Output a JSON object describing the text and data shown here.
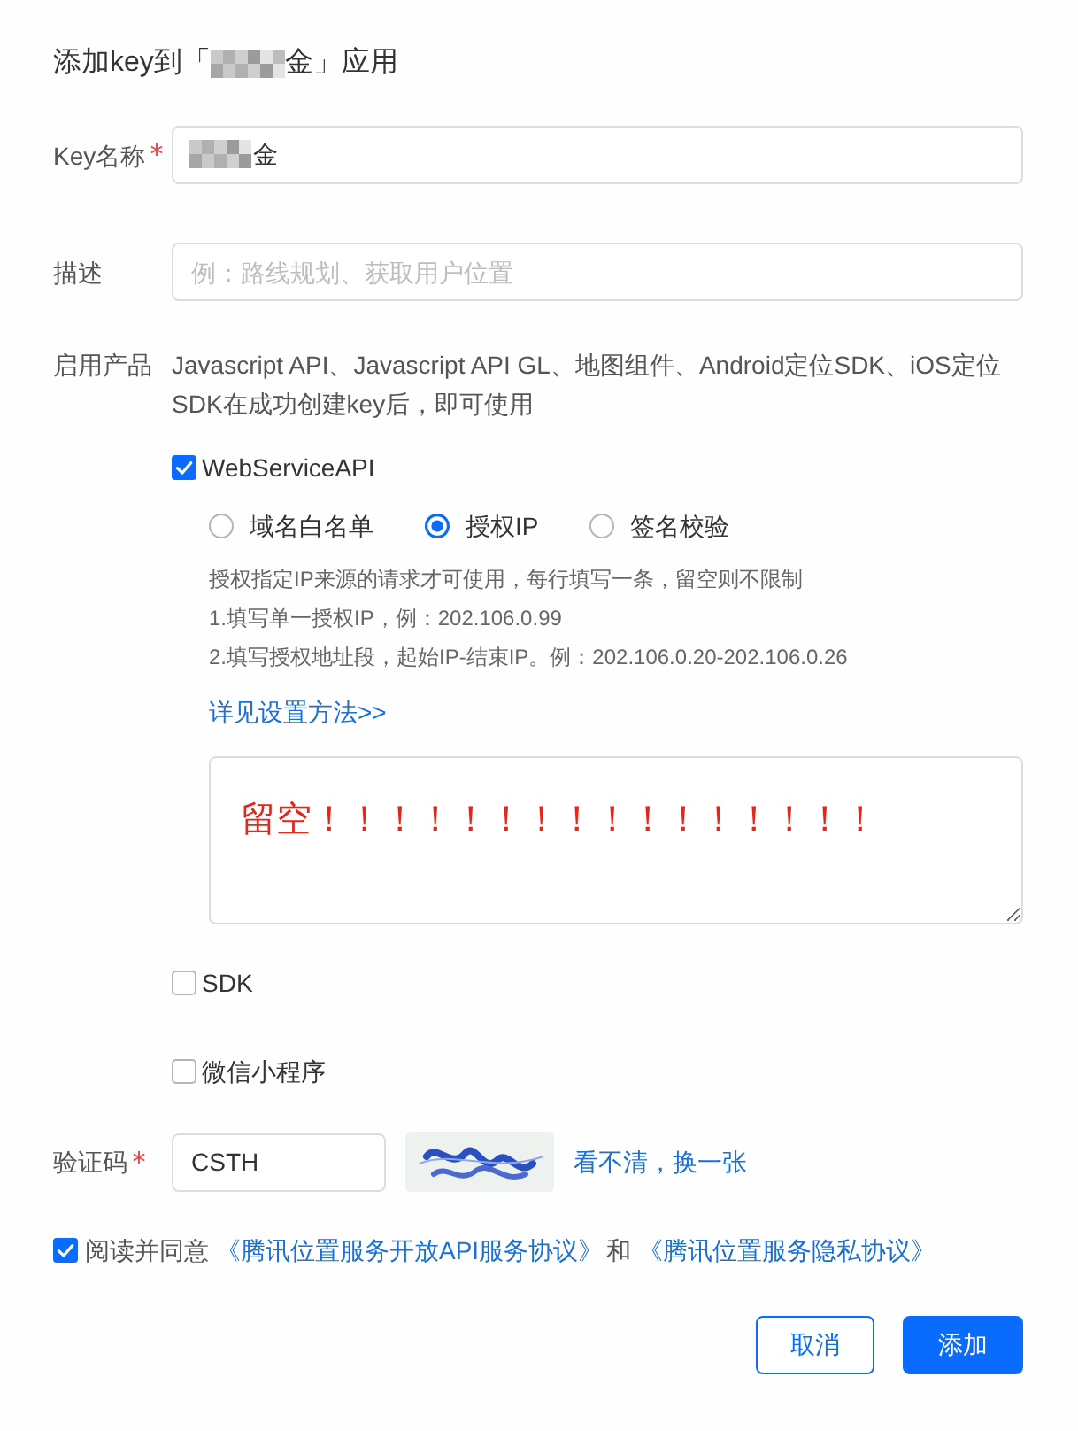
{
  "dialog": {
    "title": {
      "before": "添加key到「",
      "redacted": true,
      "after": "金」应用"
    }
  },
  "fields": [
    {
      "kind": "input",
      "label": "Key名称",
      "required": true,
      "redacted": true,
      "value": "金"
    },
    {
      "kind": "input",
      "label": "描述",
      "required": false,
      "placeholder": "例：路线规划、获取用户位置"
    }
  ],
  "products": {
    "label": "启用产品",
    "note": "Javascript API、Javascript API GL、地图组件、Android定位SDK、iOS定位SDK在成功创建key后，即可使用",
    "options": [
      {
        "label": "WebServiceAPI",
        "checked": true,
        "auth": {
          "modes": [
            {
              "label": "域名白名单",
              "selected": false
            },
            {
              "label": "授权IP",
              "selected": true
            },
            {
              "label": "签名校验",
              "selected": false
            }
          ],
          "hints": [
            "授权指定IP来源的请求才可使用，每行填写一条，留空则不限制",
            "1.填写单一授权IP，例：202.106.0.99",
            "2.填写授权地址段，起始IP-结束IP。例：202.106.0.20-202.106.0.26"
          ],
          "link": "详见设置方法>>",
          "ip_list": {
            "value": "留空！！！！！！！！！！！！！！！！"
          }
        }
      },
      {
        "label": "SDK",
        "checked": false
      },
      {
        "label": "微信小程序",
        "checked": false
      }
    ]
  },
  "captcha": {
    "label": "验证码",
    "required": true,
    "value": "CSTH",
    "refresh_link": "看不清，换一张"
  },
  "agreement": {
    "checked": true,
    "parts": [
      {
        "kind": "text",
        "text": "阅读并同意"
      },
      {
        "kind": "link",
        "text": "《腾讯位置服务开放API服务协议》"
      },
      {
        "kind": "text",
        "text": "和"
      },
      {
        "kind": "link",
        "text": "《腾讯位置服务隐私协议》"
      }
    ]
  },
  "buttons": [
    {
      "kind": "secondary",
      "label": "取消"
    },
    {
      "kind": "primary",
      "label": "添加"
    }
  ]
}
